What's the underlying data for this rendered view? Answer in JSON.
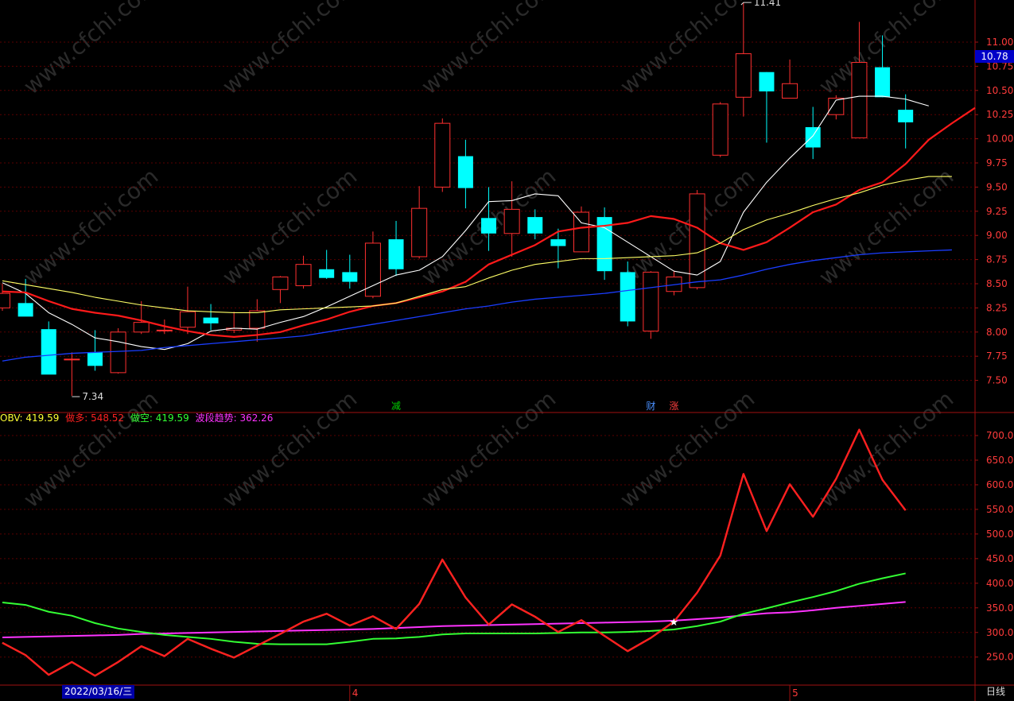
{
  "chart_data": [
    {
      "type": "candlestick",
      "price_axis": {
        "ylim": [
          7.3,
          11.55
        ],
        "ticks": [
          "11.00",
          "10.75",
          "10.50",
          "10.25",
          "10.00",
          "9.75",
          "9.50",
          "9.25",
          "9.00",
          "8.75",
          "8.50",
          "8.25",
          "8.00",
          "7.75",
          "7.50"
        ],
        "current_price": "10.78"
      },
      "annotations": {
        "high_label": "11.41",
        "low_label": "7.34"
      },
      "event_markers": [
        {
          "label": "减",
          "index": 17,
          "color": "#00d000"
        },
        {
          "label": "财",
          "index": 28,
          "color": "#4a90ff"
        },
        {
          "label": "涨",
          "index": 29,
          "color": "#ff4040"
        }
      ],
      "candles": [
        {
          "o": 8.25,
          "h": 8.5,
          "l": 8.22,
          "c": 8.4
        },
        {
          "o": 8.3,
          "h": 8.55,
          "l": 8.18,
          "c": 8.16
        },
        {
          "o": 8.03,
          "h": 8.11,
          "l": 7.62,
          "c": 7.56
        },
        {
          "o": 7.72,
          "h": 7.79,
          "l": 7.34,
          "c": 7.72
        },
        {
          "o": 7.79,
          "h": 8.02,
          "l": 7.6,
          "c": 7.65
        },
        {
          "o": 7.58,
          "h": 8.04,
          "l": 7.57,
          "c": 8.0
        },
        {
          "o": 8.0,
          "h": 8.32,
          "l": 7.98,
          "c": 8.1
        },
        {
          "o": 8.02,
          "h": 8.13,
          "l": 7.98,
          "c": 8.02
        },
        {
          "o": 8.05,
          "h": 8.47,
          "l": 7.98,
          "c": 8.21
        },
        {
          "o": 8.15,
          "h": 8.29,
          "l": 8.02,
          "c": 8.09
        },
        {
          "o": 8.02,
          "h": 8.21,
          "l": 7.99,
          "c": 8.04
        },
        {
          "o": 8.04,
          "h": 8.34,
          "l": 7.9,
          "c": 8.22
        },
        {
          "o": 8.44,
          "h": 8.58,
          "l": 8.3,
          "c": 8.57
        },
        {
          "o": 8.48,
          "h": 8.79,
          "l": 8.45,
          "c": 8.7
        },
        {
          "o": 8.65,
          "h": 8.85,
          "l": 8.55,
          "c": 8.56
        },
        {
          "o": 8.62,
          "h": 8.8,
          "l": 8.45,
          "c": 8.52
        },
        {
          "o": 8.37,
          "h": 9.04,
          "l": 8.35,
          "c": 8.92
        },
        {
          "o": 8.96,
          "h": 9.15,
          "l": 8.58,
          "c": 8.65
        },
        {
          "o": 8.78,
          "h": 9.51,
          "l": 8.76,
          "c": 9.28
        },
        {
          "o": 9.5,
          "h": 10.21,
          "l": 9.45,
          "c": 10.16
        },
        {
          "o": 9.82,
          "h": 9.99,
          "l": 9.28,
          "c": 9.49
        },
        {
          "o": 9.18,
          "h": 9.5,
          "l": 8.84,
          "c": 9.02
        },
        {
          "o": 9.02,
          "h": 9.56,
          "l": 8.78,
          "c": 9.27
        },
        {
          "o": 9.19,
          "h": 9.27,
          "l": 8.96,
          "c": 9.02
        },
        {
          "o": 8.96,
          "h": 9.07,
          "l": 8.66,
          "c": 8.89
        },
        {
          "o": 8.83,
          "h": 9.3,
          "l": 8.83,
          "c": 9.24
        },
        {
          "o": 9.19,
          "h": 9.29,
          "l": 8.54,
          "c": 8.63
        },
        {
          "o": 8.62,
          "h": 8.73,
          "l": 8.06,
          "c": 8.11
        },
        {
          "o": 8.01,
          "h": 8.63,
          "l": 7.93,
          "c": 8.62
        },
        {
          "o": 8.42,
          "h": 8.63,
          "l": 8.38,
          "c": 8.57
        },
        {
          "o": 8.46,
          "h": 9.47,
          "l": 8.44,
          "c": 9.43
        },
        {
          "o": 9.83,
          "h": 10.38,
          "l": 9.81,
          "c": 10.36
        },
        {
          "o": 10.43,
          "h": 11.41,
          "l": 10.23,
          "c": 10.88
        },
        {
          "o": 10.69,
          "h": 10.69,
          "l": 9.96,
          "c": 10.49
        },
        {
          "o": 10.42,
          "h": 10.82,
          "l": 10.42,
          "c": 10.57
        },
        {
          "o": 10.12,
          "h": 10.33,
          "l": 9.79,
          "c": 9.91
        },
        {
          "o": 10.25,
          "h": 10.45,
          "l": 10.2,
          "c": 10.42
        },
        {
          "o": 10.01,
          "h": 11.21,
          "l": 10.01,
          "c": 10.79
        },
        {
          "o": 10.74,
          "h": 11.07,
          "l": 10.43,
          "c": 10.43
        },
        {
          "o": 10.3,
          "h": 10.46,
          "l": 9.9,
          "c": 10.17
        }
      ],
      "series": [
        {
          "name": "MA5",
          "color": "#ffffff",
          "values": [
            8.51,
            8.4,
            8.2,
            8.08,
            7.94,
            7.9,
            7.85,
            7.82,
            7.88,
            8.01,
            8.04,
            8.03,
            8.1,
            8.16,
            8.26,
            8.37,
            8.48,
            8.59,
            8.64,
            8.78,
            9.05,
            9.35,
            9.36,
            9.43,
            9.41,
            9.13,
            9.08,
            8.93,
            8.78,
            8.63,
            8.59,
            8.73,
            9.24,
            9.55,
            9.8,
            10.03,
            10.4,
            10.44,
            10.44,
            10.41,
            10.34
          ]
        },
        {
          "name": "MA10",
          "color": "#ff1a1a",
          "values": [
            8.42,
            8.41,
            8.32,
            8.24,
            8.2,
            8.17,
            8.12,
            8.06,
            8.01,
            7.97,
            7.95,
            7.97,
            8.0,
            8.07,
            8.13,
            8.21,
            8.27,
            8.3,
            8.36,
            8.42,
            8.52,
            8.7,
            8.8,
            8.9,
            9.04,
            9.08,
            9.1,
            9.13,
            9.2,
            9.17,
            9.08,
            8.92,
            8.85,
            8.93,
            9.08,
            9.24,
            9.32,
            9.47,
            9.55,
            9.74,
            9.99,
            10.16,
            10.32
          ]
        },
        {
          "name": "MA20",
          "color": "#ffff66",
          "values": [
            8.53,
            8.49,
            8.45,
            8.41,
            8.36,
            8.32,
            8.28,
            8.25,
            8.22,
            8.21,
            8.2,
            8.2,
            8.23,
            8.24,
            8.25,
            8.26,
            8.27,
            8.3,
            8.37,
            8.44,
            8.47,
            8.56,
            8.64,
            8.7,
            8.73,
            8.76,
            8.76,
            8.77,
            8.78,
            8.79,
            8.82,
            8.92,
            9.06,
            9.16,
            9.23,
            9.31,
            9.38,
            9.44,
            9.52,
            9.57,
            9.61,
            9.61
          ]
        },
        {
          "name": "MA60",
          "color": "#1a3dff",
          "values": [
            7.7,
            7.74,
            7.76,
            7.78,
            7.79,
            7.8,
            7.81,
            7.84,
            7.86,
            7.88,
            7.9,
            7.92,
            7.94,
            7.96,
            8.0,
            8.04,
            8.08,
            8.12,
            8.16,
            8.2,
            8.24,
            8.27,
            8.31,
            8.34,
            8.36,
            8.38,
            8.4,
            8.43,
            8.46,
            8.49,
            8.52,
            8.54,
            8.59,
            8.65,
            8.7,
            8.74,
            8.77,
            8.8,
            8.82,
            8.83,
            8.84,
            8.85
          ]
        }
      ]
    },
    {
      "type": "line",
      "legend": [
        {
          "label": "OBV: 419.59",
          "color": "#ffff33"
        },
        {
          "label": "做多: 548.52",
          "color": "#ff2020"
        },
        {
          "label": "做空: 419.59",
          "color": "#33ff33"
        },
        {
          "label": "波段趋势: 362.26",
          "color": "#ff33ff"
        }
      ],
      "y_axis": {
        "ylim": [
          215,
          735
        ],
        "ticks": [
          "700.0",
          "650.0",
          "600.0",
          "550.0",
          "500.0",
          "450.0",
          "400.0",
          "350.0",
          "300.0",
          "250.0"
        ]
      },
      "x_labels": [
        {
          "label": "2022/03/16/三",
          "index": 3
        },
        {
          "label": "4",
          "index": 15
        },
        {
          "label": "5",
          "index": 34
        }
      ],
      "marker": {
        "symbol": "★",
        "index": 29,
        "color": "#ffffff"
      },
      "series": [
        {
          "name": "OBV",
          "color": "#ffff33",
          "values": [
            279,
            254,
            214,
            240,
            212,
            240,
            272,
            252,
            287,
            267,
            249,
            273,
            297,
            322,
            338,
            314,
            333,
            307,
            358,
            448,
            371,
            316,
            357,
            332,
            301,
            325,
            293,
            262,
            289,
            322
          ]
        },
        {
          "name": "做多",
          "color": "#ff2020",
          "values": [
            279,
            254,
            214,
            240,
            212,
            240,
            272,
            252,
            287,
            267,
            249,
            273,
            297,
            322,
            338,
            314,
            333,
            307,
            358,
            448,
            371,
            316,
            357,
            332,
            301,
            325,
            293,
            262,
            289,
            322,
            381,
            456,
            622,
            506,
            601,
            535,
            612,
            712,
            610,
            548
          ]
        },
        {
          "name": "做空",
          "color": "#33ff33",
          "values": [
            361,
            356,
            342,
            334,
            319,
            308,
            301,
            295,
            291,
            287,
            281,
            277,
            276,
            276,
            276,
            281,
            287,
            288,
            291,
            296,
            298,
            298,
            298,
            298,
            299,
            300,
            300,
            301,
            303,
            306,
            313,
            322,
            338,
            349,
            361,
            372,
            384,
            399,
            410,
            420
          ]
        },
        {
          "name": "波段趋势",
          "color": "#ff33ff",
          "values": [
            290,
            291,
            292,
            293,
            294,
            295,
            297,
            298,
            299,
            300,
            301,
            302,
            303,
            304,
            305,
            306,
            307,
            309,
            311,
            313,
            314,
            315,
            316,
            317,
            318,
            319,
            320,
            321,
            322,
            324,
            327,
            330,
            335,
            339,
            341,
            345,
            350,
            354,
            358,
            362
          ]
        }
      ]
    }
  ],
  "ui": {
    "date_label": "2022/03/16/三",
    "period_label": "日线",
    "watermark": "www.cfchi.com"
  }
}
